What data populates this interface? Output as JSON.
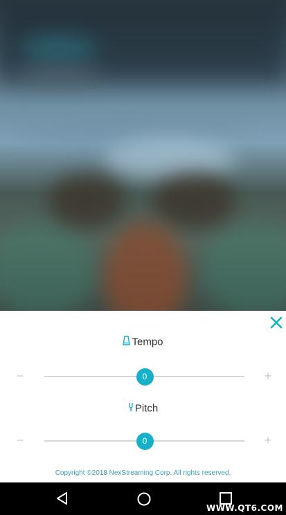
{
  "panel": {
    "tempo": {
      "label": "Tempo",
      "icon": "metronome-icon",
      "value": "0",
      "level": 0.5
    },
    "pitch": {
      "label": "Pitch",
      "icon": "tuning-fork-icon",
      "value": "0",
      "level": 0.5
    },
    "minus_symbol": "−",
    "plus_symbol": "+",
    "copyright": "Copyright ©2018 NexStreaming Corp. All rights reserved."
  },
  "colors": {
    "accent": "#16b0c8",
    "copyright_text": "#3aa0b8"
  },
  "navbar": {
    "watermark": "WWW.QT6.COM"
  }
}
